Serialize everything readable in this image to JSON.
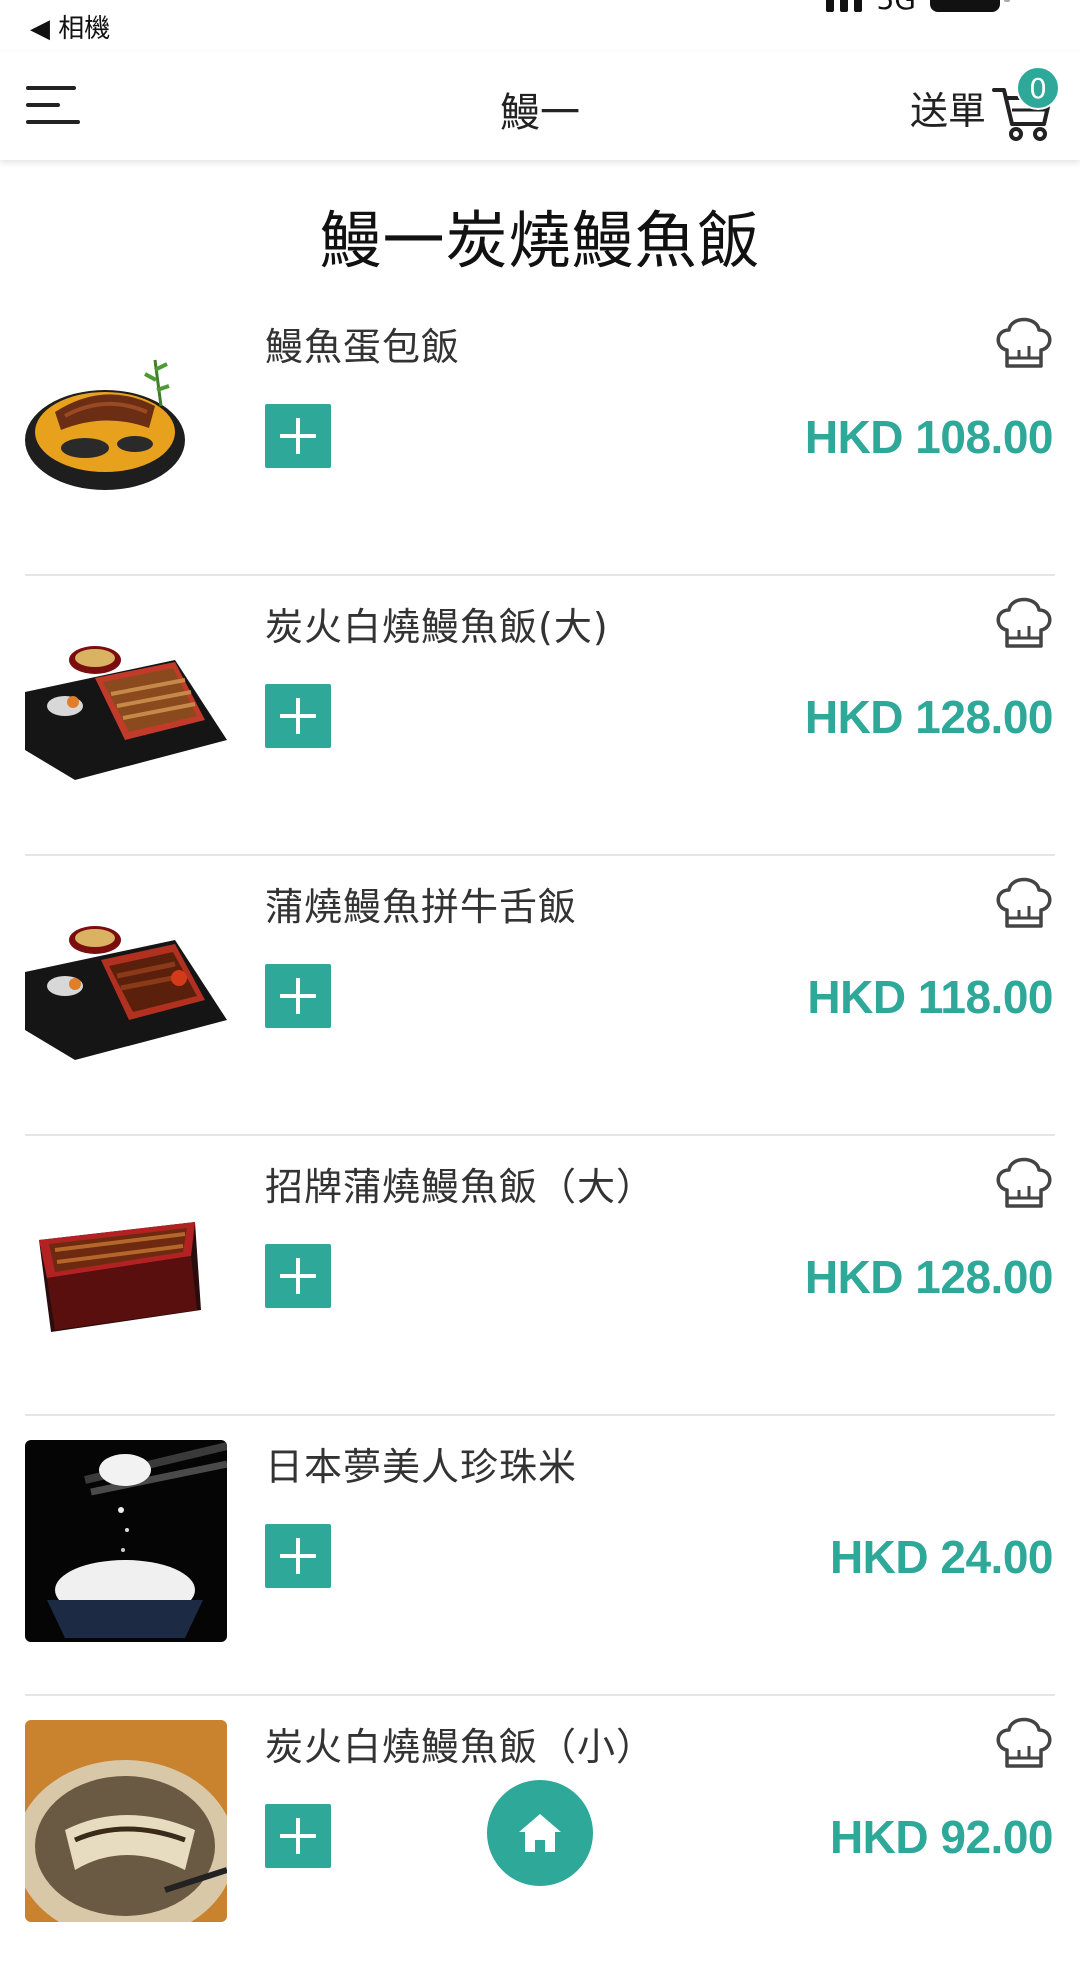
{
  "status_bar": {
    "back_label": "◀ 相機",
    "network": "5G"
  },
  "header": {
    "store_title": "鰻一",
    "send_label": "送單",
    "cart_count": "0"
  },
  "section": {
    "title": "鰻一炭燒鰻魚飯"
  },
  "items": [
    {
      "name": "鰻魚蛋包飯",
      "price": "HKD 108.00",
      "image": "eel-omelette-rice"
    },
    {
      "name": "炭火白燒鰻魚飯(大)",
      "price": "HKD 128.00",
      "image": "white-grilled-eel-bento"
    },
    {
      "name": "蒲燒鰻魚拼牛舌飯",
      "price": "HKD 118.00",
      "image": "kabayaki-eel-beef-tongue-bento"
    },
    {
      "name": "招牌蒲燒鰻魚飯（大）",
      "price": "HKD 128.00",
      "image": "signature-kabayaki-eel-box"
    },
    {
      "name": "日本夢美人珍珠米",
      "price": "HKD 24.00",
      "image": "pearl-rice-bowl"
    },
    {
      "name": "炭火白燒鰻魚飯（小）",
      "price": "HKD 92.00",
      "image": "white-grilled-eel-small"
    }
  ],
  "colors": {
    "accent": "#2ea898",
    "text": "#333333"
  },
  "icons": {
    "menu": "hamburger-icon",
    "cart": "shopping-cart-icon",
    "chef": "chef-hat-icon",
    "add": "plus-icon",
    "home": "home-icon"
  }
}
